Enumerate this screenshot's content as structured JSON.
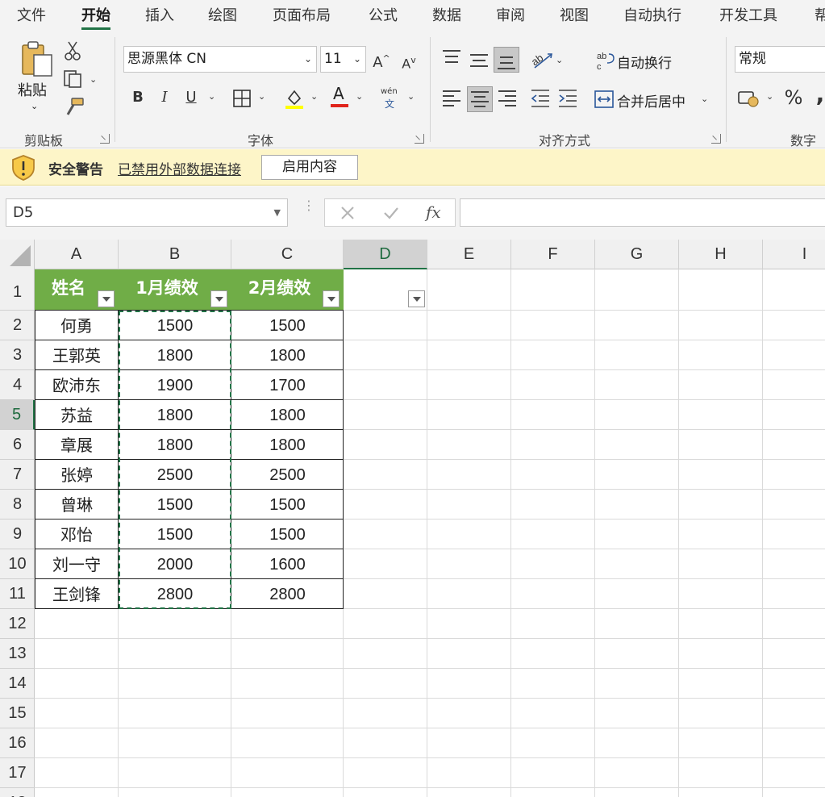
{
  "menu": {
    "tabs": [
      {
        "label": "文件"
      },
      {
        "label": "开始",
        "active": true
      },
      {
        "label": "插入"
      },
      {
        "label": "绘图"
      },
      {
        "label": "页面布局"
      },
      {
        "label": "公式"
      },
      {
        "label": "数据"
      },
      {
        "label": "审阅"
      },
      {
        "label": "视图"
      },
      {
        "label": "自动执行"
      },
      {
        "label": "开发工具"
      },
      {
        "label": "帮"
      }
    ]
  },
  "ribbon": {
    "clipboard": {
      "paste_label": "粘贴",
      "group_label": "剪贴板"
    },
    "font": {
      "font_name": "思源黑体 CN",
      "font_size": "11",
      "group_label": "字体"
    },
    "alignment": {
      "wrap_text_label": "自动换行",
      "merge_center_label": "合并后居中",
      "group_label": "对齐方式"
    },
    "number": {
      "format_value": "常规",
      "group_label": "数字"
    }
  },
  "security_bar": {
    "title": "安全警告",
    "message": "已禁用外部数据连接",
    "button_label": "启用内容"
  },
  "formula_bar": {
    "name_box": "D5",
    "formula": ""
  },
  "sheet": {
    "columns": [
      "A",
      "B",
      "C",
      "D",
      "E",
      "F",
      "G",
      "H",
      "I"
    ],
    "rows": [
      "1",
      "2",
      "3",
      "4",
      "5",
      "6",
      "7",
      "8",
      "9",
      "10",
      "11",
      "12",
      "13",
      "14",
      "15",
      "16",
      "17",
      "18"
    ],
    "selected_column": "D",
    "selected_row": "5",
    "table": {
      "headers": [
        "姓名",
        "1月绩效",
        "2月绩效"
      ],
      "rows": [
        [
          "何勇",
          "1500",
          "1500"
        ],
        [
          "王郭英",
          "1800",
          "1800"
        ],
        [
          "欧沛东",
          "1900",
          "1700"
        ],
        [
          "苏益",
          "1800",
          "1800"
        ],
        [
          "章展",
          "1800",
          "1800"
        ],
        [
          "张婷",
          "2500",
          "2500"
        ],
        [
          "曾琳",
          "1500",
          "1500"
        ],
        [
          "邓怡",
          "1500",
          "1500"
        ],
        [
          "刘一守",
          "2000",
          "1600"
        ],
        [
          "王剑锋",
          "2800",
          "2800"
        ]
      ]
    }
  },
  "colors": {
    "accent": "#217346",
    "table_header": "#70ad47",
    "security_bar": "#fdf5c8"
  }
}
